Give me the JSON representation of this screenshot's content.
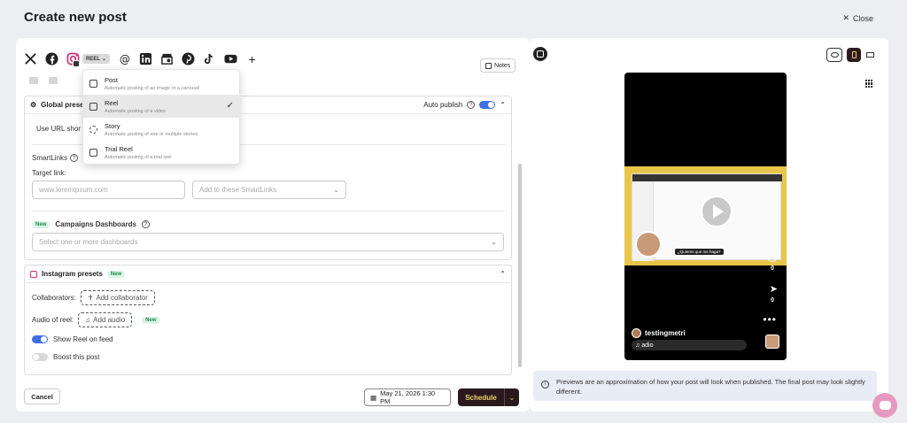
{
  "header": {
    "title": "Create new post",
    "close_label": "Close"
  },
  "composer": {
    "post_type_pill": "REEL",
    "notes_label": "Notes",
    "dropdown": {
      "items": [
        {
          "title": "Post",
          "subtitle": "Automatic posting of an image or a carousel"
        },
        {
          "title": "Reel",
          "subtitle": "Automatic posting of a video",
          "selected": true
        },
        {
          "title": "Story",
          "subtitle": "Automatic posting of one or multiple stories"
        },
        {
          "title": "Trial Reel",
          "subtitle": "Automatic posting of a trial reel"
        }
      ]
    },
    "global_presets": {
      "title": "Global preset",
      "auto_publish_label": "Auto publish",
      "auto_publish_on": true,
      "url_short_label": "Use URL shor",
      "smartlinks_label": "SmartLinks",
      "target_link_label": "Target link:",
      "target_link_placeholder": "www.loremipsum.com",
      "smartlinks_select_placeholder": "Add to these SmartLinks",
      "campaigns_new_badge": "New",
      "campaigns_label": "Campaigns Dashboards",
      "campaigns_placeholder": "Select one or more dashboards"
    },
    "instagram_presets": {
      "title": "Instagram presets",
      "new_badge": "New",
      "collaborators_label": "Collaborators:",
      "add_collaborator_label": "Add collaborator",
      "audio_label": "Audio of reel:",
      "add_audio_label": "Add audio",
      "audio_new_badge": "New",
      "show_reel_label": "Show Reel on feed",
      "show_reel_on": true,
      "boost_label": "Boost this post",
      "boost_on": false
    },
    "footer": {
      "cancel_label": "Cancel",
      "date_label": "May 21, 2026 1:30 PM",
      "schedule_label": "Schedule"
    }
  },
  "preview": {
    "username": "testingmetri",
    "audio_text": "♫ ",
    "audio_name": "adio",
    "likes_count": "0",
    "shares_count": "0",
    "caption_overlay": "¿Quieres que me haga?",
    "info_text": "Previews are an approximation of how your post will look when published. The final post may look slightly different."
  },
  "colors": {
    "accent_blue": "#3f6ee6",
    "schedule_bg": "#2a1a1d",
    "schedule_text": "#f1d36a",
    "video_bg": "#e8c64a",
    "chat_bubble": "#e69ac0"
  }
}
